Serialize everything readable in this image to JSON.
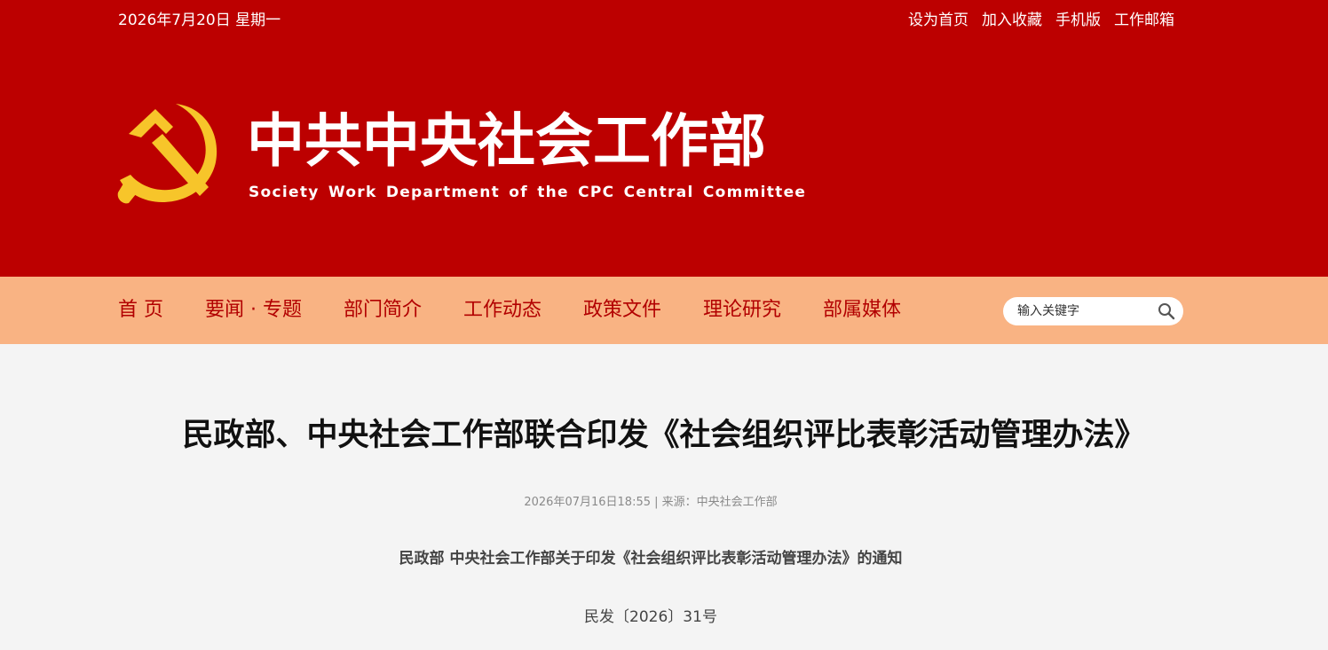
{
  "topbar": {
    "date": "2026年7月20日 星期一",
    "links": [
      "设为首页",
      "加入收藏",
      "手机版",
      "工作邮箱"
    ]
  },
  "brand": {
    "title": "中共中央社会工作部",
    "subtitle": "Society Work Department of the CPC Central Committee",
    "emblem_icon": "hammer-sickle-icon",
    "emblem_color": "#f7c52a"
  },
  "nav": {
    "items": [
      "首 页",
      "要闻 · 专题",
      "部门简介",
      "工作动态",
      "政策文件",
      "理论研究",
      "部属媒体"
    ]
  },
  "search": {
    "placeholder": "输入关键字",
    "icon": "search-icon"
  },
  "article": {
    "title": "民政部、中央社会工作部联合印发《社会组织评比表彰活动管理办法》",
    "meta": "2026年07月16日18:55 | 来源：中央社会工作部",
    "notice_title": "民政部 中央社会工作部关于印发《社会组织评比表彰活动管理办法》的通知",
    "doc_number": "民发〔2026〕31号"
  },
  "colors": {
    "header_red": "#bc0000",
    "nav_orange": "#f9b383",
    "nav_text": "#b20000",
    "page_bg": "#f4f4f4"
  }
}
